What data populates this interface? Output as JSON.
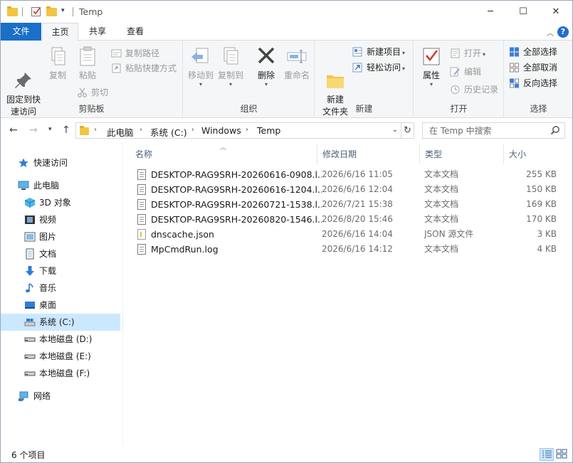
{
  "window": {
    "title": "Temp",
    "controls": {
      "minimize": "─",
      "maximize": "☐",
      "close": "✕"
    }
  },
  "ribbon_tabs": [
    {
      "label": "文件"
    },
    {
      "label": "主页"
    },
    {
      "label": "共享"
    },
    {
      "label": "查看"
    }
  ],
  "ribbon": {
    "clipboard": {
      "label": "剪贴板",
      "pin": "固定到快\n速访问",
      "copy": "复制",
      "paste": "粘贴",
      "copy_path": "复制路径",
      "paste_shortcut": "粘贴快捷方式",
      "cut": "剪切"
    },
    "organize": {
      "label": "组织",
      "move_to": "移动到",
      "copy_to": "复制到",
      "delete": "删除",
      "rename": "重命名"
    },
    "new": {
      "label": "新建",
      "new_folder": "新建\n文件夹",
      "new_item": "新建项目",
      "easy_access": "轻松访问"
    },
    "open": {
      "label": "打开",
      "properties": "属性",
      "open": "打开",
      "edit": "编辑",
      "history": "历史记录"
    },
    "select": {
      "label": "选择",
      "select_all": "全部选择",
      "select_none": "全部取消",
      "invert": "反向选择"
    }
  },
  "address": {
    "crumbs": [
      "此电脑",
      "系统 (C:)",
      "Windows",
      "Temp"
    ],
    "search_placeholder": "在 Temp 中搜索"
  },
  "nav": {
    "quick_access": "快速访问",
    "this_pc": "此电脑",
    "objects_3d": "3D 对象",
    "videos": "视频",
    "pictures": "图片",
    "documents": "文档",
    "downloads": "下载",
    "music": "音乐",
    "desktop": "桌面",
    "drive_c": "系统 (C:)",
    "drive_d": "本地磁盘 (D:)",
    "drive_e": "本地磁盘 (E:)",
    "drive_f": "本地磁盘 (F:)",
    "network": "网络"
  },
  "columns": {
    "name": "名称",
    "date": "修改日期",
    "type": "类型",
    "size": "大小"
  },
  "files": [
    {
      "name": "DESKTOP-RAG9SRH-20260616-0908.l...",
      "date": "2026/6/16 11:05",
      "type": "文本文档",
      "size": "255 KB"
    },
    {
      "name": "DESKTOP-RAG9SRH-20260616-1204.l...",
      "date": "2026/6/16 12:04",
      "type": "文本文档",
      "size": "150 KB"
    },
    {
      "name": "DESKTOP-RAG9SRH-20260721-1538.l...",
      "date": "2026/7/21 15:38",
      "type": "文本文档",
      "size": "169 KB"
    },
    {
      "name": "DESKTOP-RAG9SRH-20260820-1546.l...",
      "date": "2026/8/20 15:46",
      "type": "文本文档",
      "size": "170 KB"
    },
    {
      "name": "dnscache.json",
      "date": "2026/6/16 14:04",
      "type": "JSON 源文件",
      "size": "3 KB"
    },
    {
      "name": "MpCmdRun.log",
      "date": "2026/6/16 14:12",
      "type": "文本文档",
      "size": "4 KB"
    }
  ],
  "status": {
    "item_count": "6 个项目"
  },
  "colors": {
    "accent": "#1a6fc7",
    "selection": "#cce8ff",
    "ribbon_bg": "#f5f6f7"
  }
}
